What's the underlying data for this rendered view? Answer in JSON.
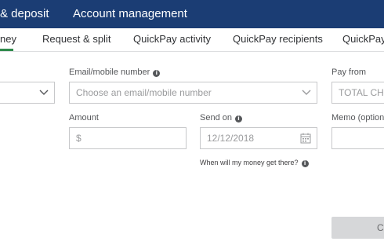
{
  "top_nav": {
    "item1": "& deposit",
    "item2": "Account management"
  },
  "sub_tabs": [
    "ney",
    "Request & split",
    "QuickPay activity",
    "QuickPay recipients",
    "QuickPay"
  ],
  "form": {
    "email_label": "Email/mobile number",
    "email_placeholder": "Choose an email/mobile number",
    "pay_from_label": "Pay from",
    "pay_from_value": "TOTAL CHE",
    "amount_label": "Amount",
    "amount_placeholder": "$",
    "send_on_label": "Send on",
    "send_on_value": "12/12/2018",
    "memo_label": "Memo (optiona",
    "hint_text": "When will my money get there?"
  },
  "button": {
    "label": "C"
  },
  "colors": {
    "top_bar": "#1b3d74",
    "active_tab_underline": "#2f8a4b"
  },
  "icons": [
    "info-icon",
    "chevron-down-icon",
    "calendar-icon"
  ]
}
